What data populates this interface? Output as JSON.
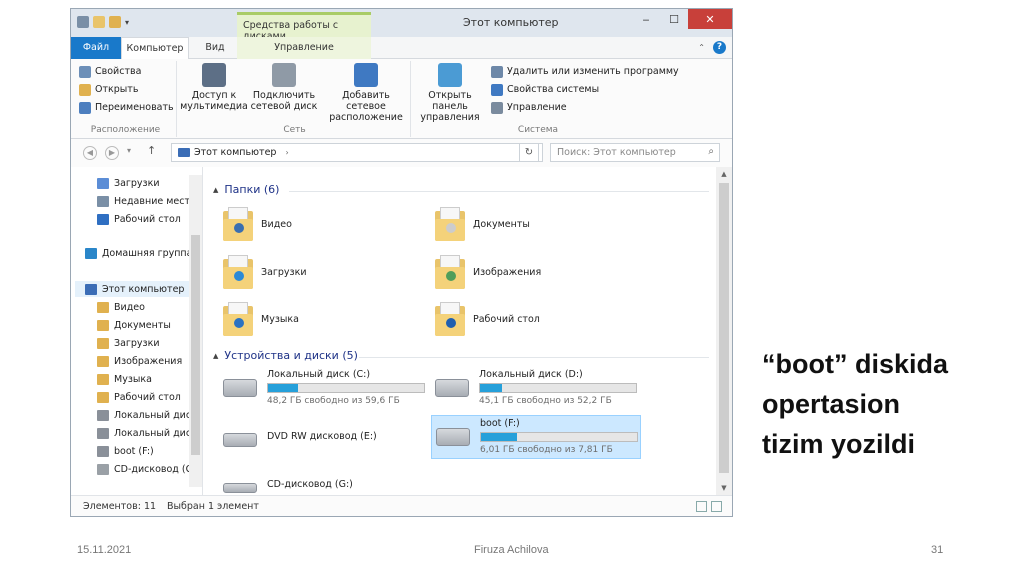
{
  "window": {
    "title": "Этот компьютер",
    "context_tab_group": "Средства работы с дисками",
    "tabs": [
      "Файл",
      "Компьютер",
      "Вид",
      "Управление"
    ]
  },
  "ribbon": {
    "location_group": {
      "name": "Расположение",
      "buttons": [
        "Свойства",
        "Открыть",
        "Переименовать"
      ]
    },
    "network_group": {
      "name": "Сеть",
      "buttons": [
        "Доступ к мультимедиа",
        "Подключить сетевой диск",
        "Добавить сетевое расположение"
      ]
    },
    "system_group": {
      "name": "Система",
      "big_button": "Открыть панель управления",
      "buttons": [
        "Удалить или изменить программу",
        "Свойства системы",
        "Управление"
      ]
    }
  },
  "address": {
    "path": "Этот компьютер",
    "search_placeholder": "Поиск: Этот компьютер"
  },
  "sidebar": {
    "items": [
      {
        "label": "Загрузки",
        "color": "#5b8dd6"
      },
      {
        "label": "Недавние места",
        "color": "#7a8fa6"
      },
      {
        "label": "Рабочий стол",
        "color": "#2f6fc2"
      },
      {
        "label": "Домашняя группа",
        "color": "#2a86c9"
      },
      {
        "label": "Этот компьютер",
        "color": "#3b6db6"
      },
      {
        "label": "Видео",
        "color": "#e0b14f"
      },
      {
        "label": "Документы",
        "color": "#e0b14f"
      },
      {
        "label": "Загрузки",
        "color": "#e0b14f"
      },
      {
        "label": "Изображения",
        "color": "#e0b14f"
      },
      {
        "label": "Музыка",
        "color": "#e0b14f"
      },
      {
        "label": "Рабочий стол",
        "color": "#e0b14f"
      },
      {
        "label": "Локальный диск",
        "color": "#8a9099"
      },
      {
        "label": "Локальный диск",
        "color": "#8a9099"
      },
      {
        "label": "boot (F:)",
        "color": "#8a9099"
      },
      {
        "label": "CD-дисковод (G:",
        "color": "#9aa0a6"
      }
    ]
  },
  "folders_section": {
    "header": "Папки (6)",
    "items": [
      {
        "label": "Видео",
        "mark": "#3a6fb0"
      },
      {
        "label": "Документы",
        "mark": "#cccccc"
      },
      {
        "label": "Загрузки",
        "mark": "#2b8ad6"
      },
      {
        "label": "Изображения",
        "mark": "#4f9e5a"
      },
      {
        "label": "Музыка",
        "mark": "#2b72c2"
      },
      {
        "label": "Рабочий стол",
        "mark": "#1f5fb0"
      }
    ]
  },
  "drives_section": {
    "header": "Устройства и диски (5)",
    "drives": [
      {
        "name": "Локальный диск (C:)",
        "info": "48,2 ГБ свободно из 59,6 ГБ",
        "used_fraction": 0.19
      },
      {
        "name": "Локальный диск (D:)",
        "info": "45,1 ГБ свободно из 52,2 ГБ",
        "used_fraction": 0.14
      },
      {
        "name": "DVD RW дисковод (E:)"
      },
      {
        "name": "boot (F:)",
        "info": "6,01 ГБ свободно из 7,81 ГБ",
        "used_fraction": 0.23
      },
      {
        "name": "CD-дисковод (G:)"
      }
    ]
  },
  "status": {
    "count": "Элементов: 11",
    "selected": "Выбран 1 элемент"
  },
  "caption": {
    "line1": "“boot” diskida",
    "line2": "opertasion",
    "line3": "tizim yozildi"
  },
  "footer": {
    "date": "15.11.2021",
    "author": "Firuza Achilova",
    "page": "31"
  }
}
